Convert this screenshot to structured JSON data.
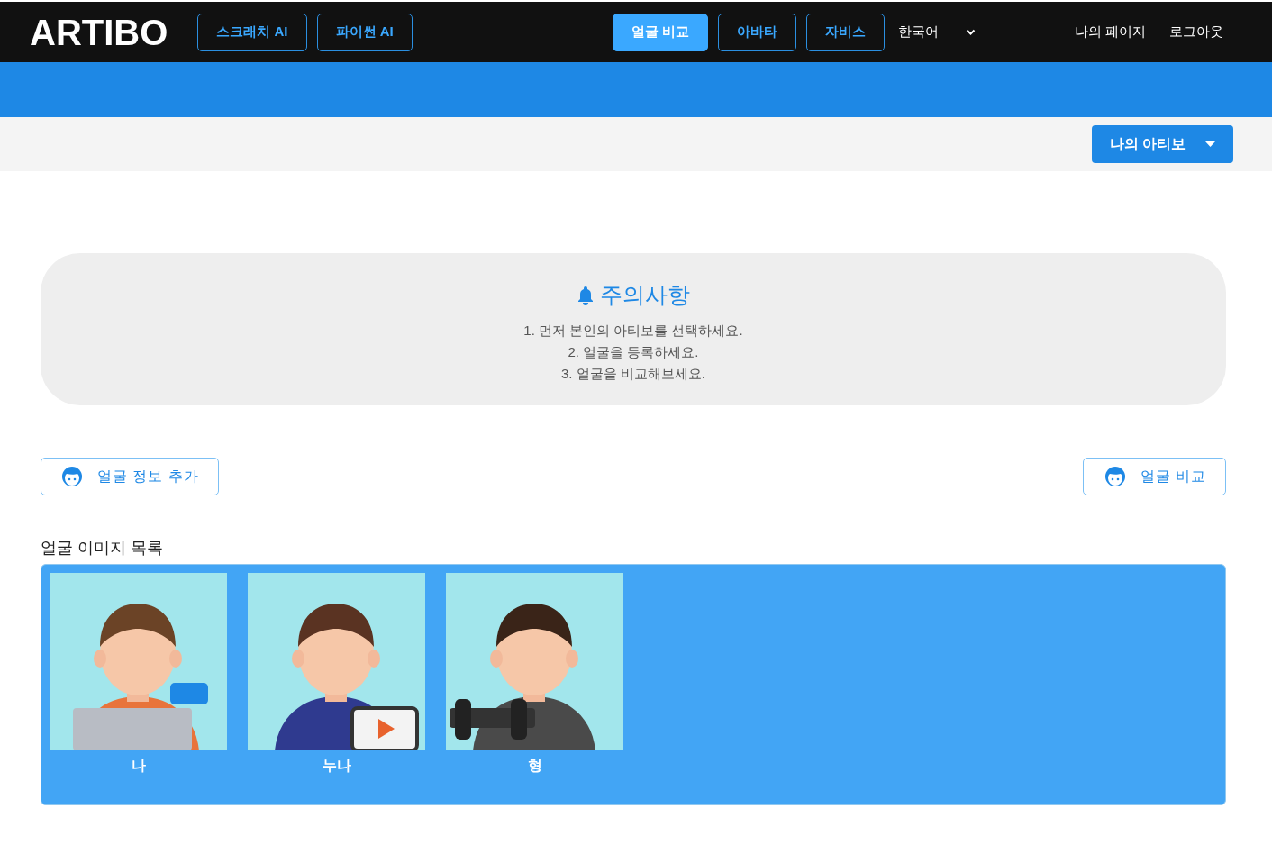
{
  "header": {
    "logo": "ARTIBO",
    "nav": [
      {
        "label": "스크래치 AI",
        "selected": false
      },
      {
        "label": "파이썬 AI",
        "selected": false
      },
      {
        "label": "얼굴 비교",
        "selected": true
      },
      {
        "label": "아바타",
        "selected": false
      },
      {
        "label": "자비스",
        "selected": false
      }
    ],
    "language": "한국어",
    "links": [
      "나의 페이지",
      "로그아웃"
    ]
  },
  "toolbar": {
    "dropdown": "나의 아티보"
  },
  "notice": {
    "title": "주의사항",
    "lines": [
      "1. 먼저 본인의 아티보를 선택하세요.",
      "2. 얼굴을 등록하세요.",
      "3. 얼굴을 비교해보세요."
    ]
  },
  "actions": [
    "얼굴 정보 추가",
    "얼굴 비교"
  ],
  "gallery": {
    "title": "얼굴 이미지 목록",
    "items": [
      {
        "caption": "나",
        "kind": "picture"
      },
      {
        "caption": "누나",
        "kind": "picture"
      },
      {
        "caption": "형",
        "kind": "picture"
      }
    ]
  }
}
